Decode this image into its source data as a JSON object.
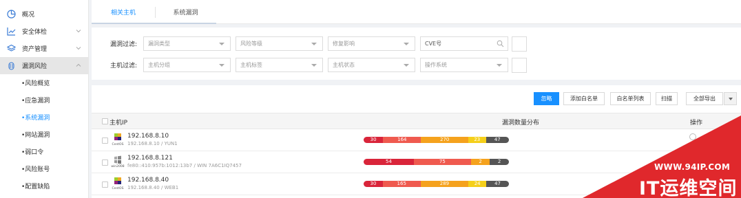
{
  "sidebar": {
    "items": [
      {
        "label": "概况"
      },
      {
        "label": "安全体检"
      },
      {
        "label": "资产管理"
      },
      {
        "label": "漏洞风险"
      }
    ],
    "sub_items": [
      {
        "label": "•风险概览"
      },
      {
        "label": "•应急漏洞"
      },
      {
        "label": "•系统漏洞"
      },
      {
        "label": "•网站漏洞"
      },
      {
        "label": "•弱口令"
      },
      {
        "label": "•风险账号"
      },
      {
        "label": "•配置缺陷"
      }
    ]
  },
  "tabs": [
    {
      "label": "相关主机"
    },
    {
      "label": "系统漏洞"
    }
  ],
  "filters": {
    "vuln_label": "漏洞过滤:",
    "host_label": "主机过滤:",
    "vuln_type": "漏洞类型",
    "risk_level": "风险等级",
    "fix_impact": "修复影响",
    "cve_value": "CVE号",
    "host_group": "主机分组",
    "host_tag": "主机标签",
    "host_status": "主机状态",
    "os": "操作系统"
  },
  "toolbar": {
    "ignore": "忽略",
    "add_whitelist": "添加白名单",
    "whitelist": "白名单列表",
    "scan": "扫描",
    "export_all": "全部导出"
  },
  "table": {
    "headers": {
      "host_ip": "主机IP",
      "distribution": "漏洞数量分布",
      "action": "操作"
    },
    "rows": [
      {
        "os": "CentOS",
        "ip": "192.168.8.10",
        "sub": "192.168.8.10 / YUN1",
        "segments": [
          {
            "value": "30",
            "count": 30,
            "color": "#d9253a"
          },
          {
            "value": "164",
            "count": 164,
            "color": "#ef5a4f"
          },
          {
            "value": "270",
            "count": 270,
            "color": "#f5a21d"
          },
          {
            "value": "23",
            "count": 23,
            "color": "#f5cf1a"
          },
          {
            "value": "47",
            "count": 47,
            "color": "#555555"
          }
        ]
      },
      {
        "os": "win2008",
        "ip": "192.168.8.121",
        "sub": "fe80::410:957b:1012:13b7 / WIN 7A6C1IQ7457",
        "segments": [
          {
            "value": "54",
            "count": 54,
            "color": "#d9253a"
          },
          {
            "value": "75",
            "count": 75,
            "color": "#ef5a4f"
          },
          {
            "value": "2",
            "count": 2,
            "color": "#f5a21d"
          },
          {
            "value": "2",
            "count": 2,
            "color": "#555555"
          }
        ]
      },
      {
        "os": "CentOS",
        "ip": "192.168.8.40",
        "sub": "192.168.8.40 / WEB1",
        "segments": [
          {
            "value": "30",
            "count": 30,
            "color": "#d9253a"
          },
          {
            "value": "165",
            "count": 165,
            "color": "#ef5a4f"
          },
          {
            "value": "289",
            "count": 289,
            "color": "#f5a21d"
          },
          {
            "value": "24",
            "count": 24,
            "color": "#f5cf1a"
          },
          {
            "value": "47",
            "count": 47,
            "color": "#555555"
          }
        ]
      }
    ]
  },
  "watermark": {
    "url": "WWW.94IP.COM",
    "name": "IT运维空间"
  },
  "colors": {
    "accent": "#1890ff",
    "watermark": "#e0282c"
  }
}
